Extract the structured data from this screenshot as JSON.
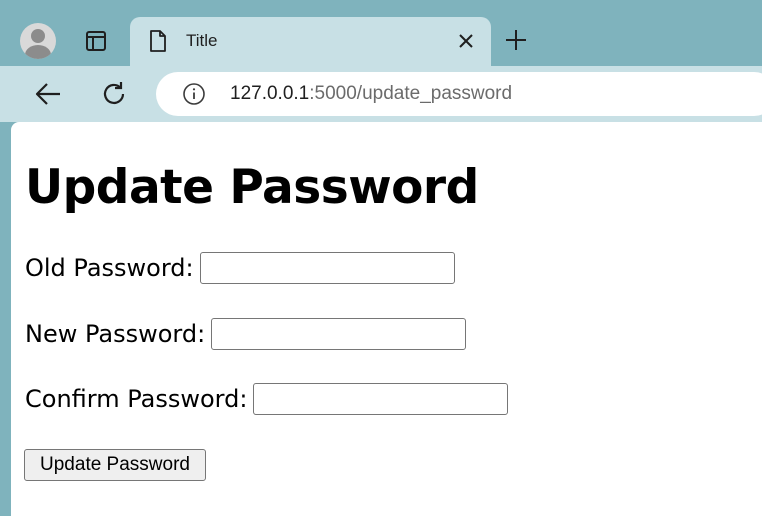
{
  "browser": {
    "tab_title": "Title",
    "url_host": "127.0.0.1",
    "url_path": ":5000/update_password"
  },
  "page": {
    "heading": "Update Password",
    "fields": {
      "old_label": "Old Password:",
      "old_value": "",
      "new_label": "New Password:",
      "new_value": "",
      "confirm_label": "Confirm Password:",
      "confirm_value": ""
    },
    "submit_label": "Update Password"
  },
  "colors": {
    "tabstrip_bg": "#7fb3bd",
    "toolbar_bg": "#c8e0e5",
    "page_bg": "#ffffff"
  },
  "icons": [
    "profile-avatar-icon",
    "tab-actions-icon",
    "document-icon",
    "close-icon",
    "plus-icon",
    "back-arrow-icon",
    "reload-icon",
    "info-icon"
  ]
}
